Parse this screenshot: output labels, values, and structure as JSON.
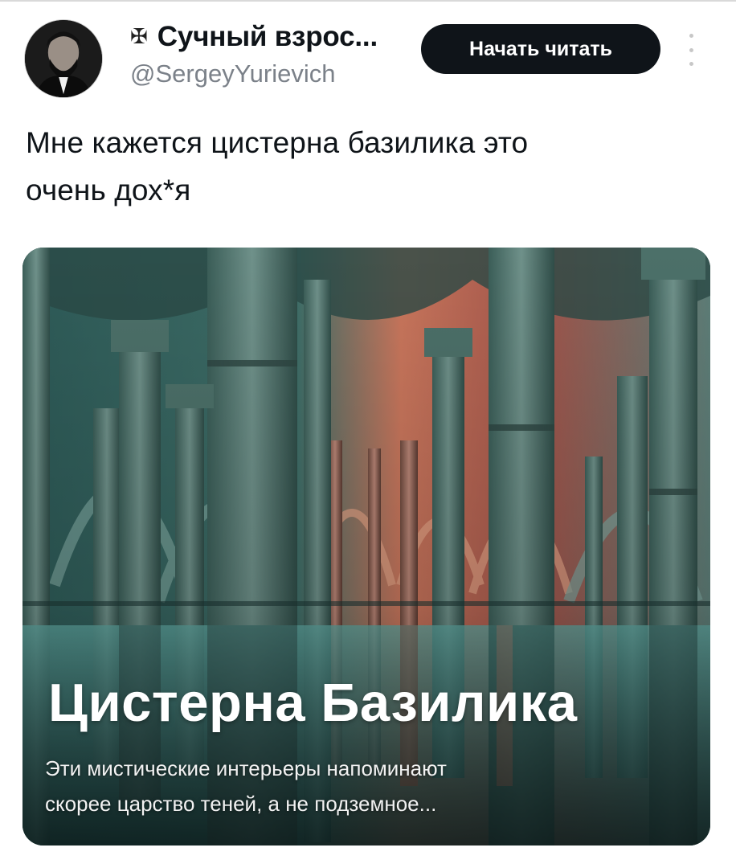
{
  "author": {
    "name_prefix_glyph": "✠",
    "display_name": "Сучный взрос...",
    "handle": "@SergeyYurievich",
    "avatar_icon": "portrait-avatar"
  },
  "actions": {
    "follow_label": "Начать читать",
    "more_icon": "vertical-ellipsis-icon"
  },
  "tweet": {
    "lines": [
      "Мне кажется цистерна базилика это",
      "очень дох*я"
    ]
  },
  "media_card": {
    "image_subject": "basilica-cistern-columns",
    "title": "Цистерна Базилика",
    "subtitle_lines": [
      "Эти мистические интерьеры напоминают",
      "скорее царство теней, а не подземное..."
    ]
  },
  "colors": {
    "button_bg": "#0f1419",
    "button_text": "#ffffff",
    "handle_text": "#7b8189",
    "primary_text": "#0f1419"
  }
}
